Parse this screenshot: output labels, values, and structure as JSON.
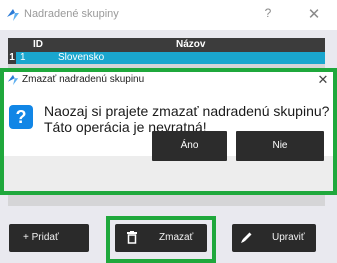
{
  "window": {
    "title": "Nadradené skupiny",
    "help_symbol": "?",
    "close_symbol": "✕"
  },
  "grid": {
    "columns": [
      "ID",
      "Názov"
    ],
    "rows": [
      {
        "row_number": "1",
        "id": "1",
        "name": "Slovensko"
      }
    ]
  },
  "toolbar": {
    "add_label": "+ Pridať",
    "delete_label": "Zmazať",
    "edit_label": "Upraviť",
    "add_icon": "plus-icon",
    "delete_icon": "trash-icon",
    "edit_icon": "pencil-icon"
  },
  "dialog": {
    "title": "Zmazať nadradenú skupinu",
    "close_symbol": "✕",
    "icon": "question-icon",
    "message_line1": "Naozaj si prajete zmazať nadradenú skupinu?",
    "message_line2": "Táto operácia je nevratná!",
    "yes_label": "Áno",
    "no_label": "Nie"
  },
  "colors": {
    "highlight": "#1fa83c",
    "selection": "#1aa6ce",
    "question_icon": "#1186e6",
    "button_dark": "#2a2a2a"
  }
}
